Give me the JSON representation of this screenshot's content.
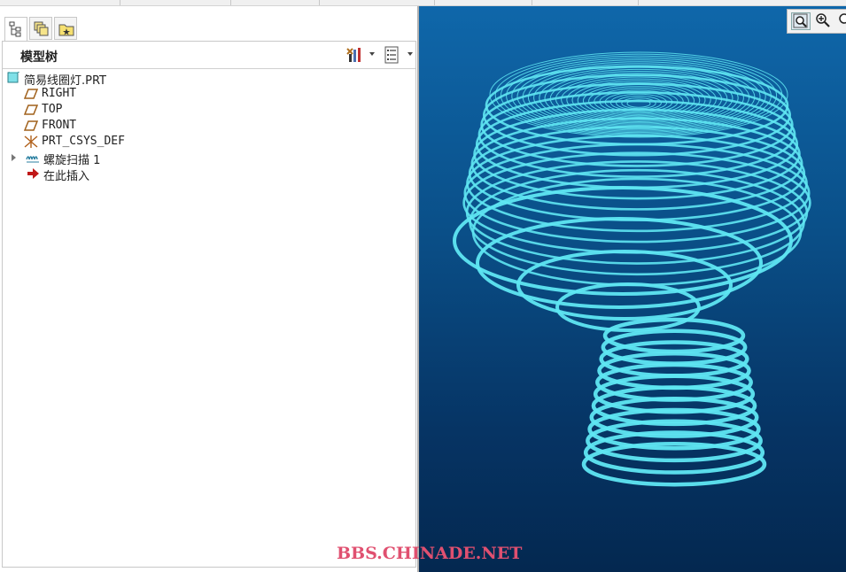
{
  "model_tree": {
    "title": "模型树",
    "tabs": [
      {
        "name": "model-tree-tab",
        "active": true
      },
      {
        "name": "layer-tree-tab",
        "active": false
      },
      {
        "name": "favorites-tab",
        "active": false
      }
    ],
    "items": [
      {
        "label": "简易线圈灯.PRT",
        "icon": "part-icon",
        "expandable": false
      },
      {
        "label": "RIGHT",
        "icon": "datum-plane-icon",
        "expandable": false
      },
      {
        "label": "TOP",
        "icon": "datum-plane-icon",
        "expandable": false
      },
      {
        "label": "FRONT",
        "icon": "datum-plane-icon",
        "expandable": false
      },
      {
        "label": "PRT_CSYS_DEF",
        "icon": "coordinate-system-icon",
        "expandable": false
      },
      {
        "label": "螺旋扫描 1",
        "icon": "helical-sweep-icon",
        "expandable": true
      },
      {
        "label": "在此插入",
        "icon": "insert-here-arrow-icon",
        "expandable": false
      }
    ]
  },
  "viewport": {
    "tools": [
      "zoom-fit-icon",
      "zoom-in-icon",
      "zoom-out-icon"
    ],
    "model_color": "#5fe6f2"
  },
  "watermark": "BBS.CHINADE.NET"
}
